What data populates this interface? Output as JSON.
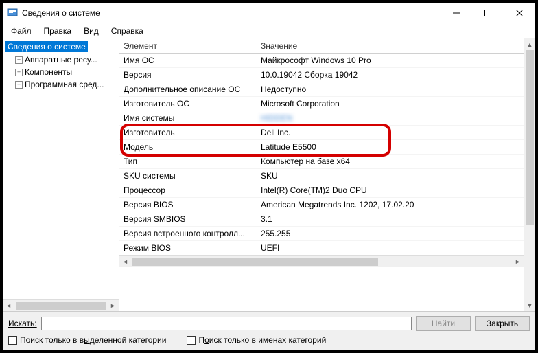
{
  "title": "Сведения о системе",
  "menu": [
    "Файл",
    "Правка",
    "Вид",
    "Справка"
  ],
  "tree": {
    "root": "Сведения о системе",
    "items": [
      "Аппаратные ресу...",
      "Компоненты",
      "Программная сред..."
    ]
  },
  "columns": {
    "key": "Элемент",
    "value": "Значение"
  },
  "rows": [
    {
      "k": "Имя ОС",
      "v": "Майкрософт Windows 10 Pro"
    },
    {
      "k": "Версия",
      "v": "10.0.19042 Сборка 19042"
    },
    {
      "k": "Дополнительное описание ОС",
      "v": "Недоступно"
    },
    {
      "k": "Изготовитель ОС",
      "v": "Microsoft Corporation"
    },
    {
      "k": "Имя системы",
      "v": "HIDDEN",
      "blur": true
    },
    {
      "k": "Изготовитель",
      "v": "Dell Inc."
    },
    {
      "k": "Модель",
      "v": "Latitude E5500"
    },
    {
      "k": "Тип",
      "v": "Компьютер на базе x64"
    },
    {
      "k": "SKU системы",
      "v": "SKU"
    },
    {
      "k": "Процессор",
      "v": "Intel(R) Core(TM)2 Duo CPU"
    },
    {
      "k": "Версия BIOS",
      "v": "American Megatrends Inc. 1202, 17.02.20"
    },
    {
      "k": "Версия SMBIOS",
      "v": "3.1"
    },
    {
      "k": "Версия встроенного контролл...",
      "v": "255.255"
    },
    {
      "k": "Режим BIOS",
      "v": "UEFI"
    }
  ],
  "highlight_rows": [
    5,
    6
  ],
  "footer": {
    "find_label": "Искать:",
    "find_btn": "Найти",
    "close_btn": "Закрыть",
    "chk1_pre": "Поиск только в в",
    "chk1_u": "ы",
    "chk1_post": "деленной категории",
    "chk2_pre": "П",
    "chk2_u": "о",
    "chk2_post": "иск только в именах категорий"
  }
}
